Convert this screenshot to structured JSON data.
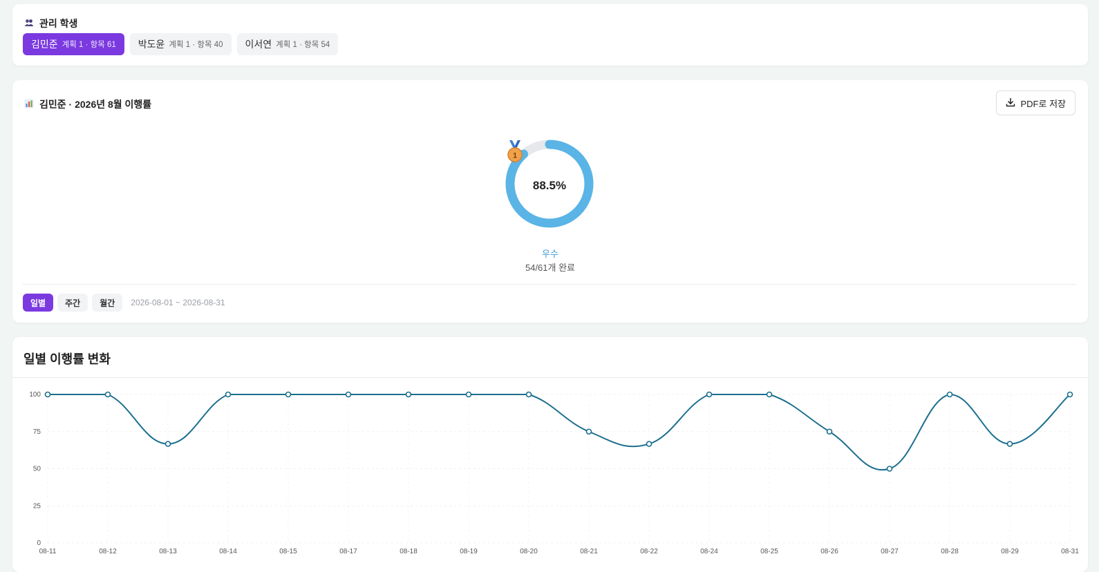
{
  "students_card": {
    "title": "관리 학생",
    "students": [
      {
        "name": "김민준",
        "meta": "계획 1 · 항목 61",
        "active": true
      },
      {
        "name": "박도윤",
        "meta": "계획 1 · 항목 40",
        "active": false
      },
      {
        "name": "이서연",
        "meta": "계획 1 · 항목 54",
        "active": false
      }
    ]
  },
  "report": {
    "title": "김민준 · 2026년 8월 이행률",
    "pdf_label": "PDF로 저장",
    "percent_label": "88.5%",
    "percent_value": 88.5,
    "grade": "우수",
    "done": "54/61개 완료",
    "periods": [
      "일별",
      "주간",
      "월간"
    ],
    "active_period": "일별",
    "range": "2026-08-01 ~ 2026-08-31",
    "colors": {
      "ring": "#5ab4e6",
      "ring_track": "#e6e8eb",
      "accent": "#7b39e0"
    }
  },
  "chart_section": {
    "title": "일별 이행률 변화"
  },
  "chart_data": {
    "type": "line",
    "categories": [
      "08-11",
      "08-12",
      "08-13",
      "08-14",
      "08-15",
      "08-17",
      "08-18",
      "08-19",
      "08-20",
      "08-21",
      "08-22",
      "08-24",
      "08-25",
      "08-26",
      "08-27",
      "08-28",
      "08-29",
      "08-31"
    ],
    "values": [
      100,
      100,
      66.7,
      100,
      100,
      100,
      100,
      100,
      100,
      75,
      66.7,
      100,
      100,
      75,
      50,
      100,
      66.7,
      100
    ],
    "yticks": [
      0,
      25,
      50,
      75,
      100
    ],
    "ylim": [
      0,
      100
    ],
    "grid": true,
    "color": "#1a6e8e"
  }
}
